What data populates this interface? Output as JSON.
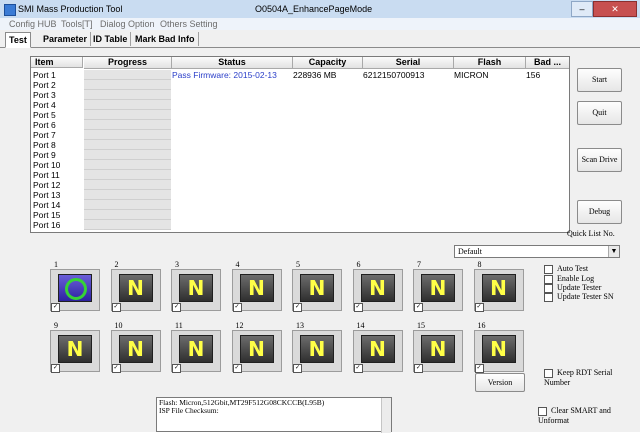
{
  "app": {
    "title": "SMI Mass Production Tool",
    "window_title": "O0504A_EnhancePageMode"
  },
  "menu": [
    "Config HUB",
    "Tools[T]",
    "Dialog Option",
    "Others Setting"
  ],
  "tabs": [
    "Test",
    "Parameter",
    "ID Table",
    "Mark Bad Info"
  ],
  "table": {
    "headers": [
      "Item",
      "Progress",
      "Status",
      "Capacity",
      "Serial",
      "Flash",
      "Bad ..."
    ],
    "rows": [
      {
        "item": "Port 1",
        "status": "Pass   Firmware: 2015-02-13",
        "capacity": "228936 MB",
        "serial": "6212150700913",
        "flash": "MICRON",
        "bad": "156"
      },
      {
        "item": "Port 2",
        "status": "",
        "capacity": "",
        "serial": "",
        "flash": "",
        "bad": ""
      },
      {
        "item": "Port 3",
        "status": "",
        "capacity": "",
        "serial": "",
        "flash": "",
        "bad": ""
      },
      {
        "item": "Port 4",
        "status": "",
        "capacity": "",
        "serial": "",
        "flash": "",
        "bad": ""
      },
      {
        "item": "Port 5",
        "status": "",
        "capacity": "",
        "serial": "",
        "flash": "",
        "bad": ""
      },
      {
        "item": "Port 6",
        "status": "",
        "capacity": "",
        "serial": "",
        "flash": "",
        "bad": ""
      },
      {
        "item": "Port 7",
        "status": "",
        "capacity": "",
        "serial": "",
        "flash": "",
        "bad": ""
      },
      {
        "item": "Port 8",
        "status": "",
        "capacity": "",
        "serial": "",
        "flash": "",
        "bad": ""
      },
      {
        "item": "Port 9",
        "status": "",
        "capacity": "",
        "serial": "",
        "flash": "",
        "bad": ""
      },
      {
        "item": "Port 10",
        "status": "",
        "capacity": "",
        "serial": "",
        "flash": "",
        "bad": ""
      },
      {
        "item": "Port 11",
        "status": "",
        "capacity": "",
        "serial": "",
        "flash": "",
        "bad": ""
      },
      {
        "item": "Port 12",
        "status": "",
        "capacity": "",
        "serial": "",
        "flash": "",
        "bad": ""
      },
      {
        "item": "Port 13",
        "status": "",
        "capacity": "",
        "serial": "",
        "flash": "",
        "bad": ""
      },
      {
        "item": "Port 14",
        "status": "",
        "capacity": "",
        "serial": "",
        "flash": "",
        "bad": ""
      },
      {
        "item": "Port 15",
        "status": "",
        "capacity": "",
        "serial": "",
        "flash": "",
        "bad": ""
      },
      {
        "item": "Port 16",
        "status": "",
        "capacity": "",
        "serial": "",
        "flash": "",
        "bad": ""
      }
    ]
  },
  "buttons": {
    "start": "Start",
    "quit": "Quit",
    "scan_drive": "Scan Drive",
    "debug": "Debug",
    "version": "Version"
  },
  "quick_list": {
    "label": "Quick List No.",
    "selected": "Default"
  },
  "ports": [
    {
      "num": "1",
      "letter": "O",
      "state": "ok"
    },
    {
      "num": "2",
      "letter": "N",
      "state": "none"
    },
    {
      "num": "3",
      "letter": "N",
      "state": "none"
    },
    {
      "num": "4",
      "letter": "N",
      "state": "none"
    },
    {
      "num": "5",
      "letter": "N",
      "state": "none"
    },
    {
      "num": "6",
      "letter": "N",
      "state": "none"
    },
    {
      "num": "7",
      "letter": "N",
      "state": "none"
    },
    {
      "num": "8",
      "letter": "N",
      "state": "none"
    },
    {
      "num": "9",
      "letter": "N",
      "state": "none"
    },
    {
      "num": "10",
      "letter": "N",
      "state": "none"
    },
    {
      "num": "11",
      "letter": "N",
      "state": "none"
    },
    {
      "num": "12",
      "letter": "N",
      "state": "none"
    },
    {
      "num": "13",
      "letter": "N",
      "state": "none"
    },
    {
      "num": "14",
      "letter": "N",
      "state": "none"
    },
    {
      "num": "15",
      "letter": "N",
      "state": "none"
    },
    {
      "num": "16",
      "letter": "N",
      "state": "none"
    }
  ],
  "options": [
    "Auto Test",
    "Enable Log",
    "Update Tester",
    "Update Tester SN"
  ],
  "keep_rdt": "Keep RDT Serial Number",
  "clear_smart": "Clear SMART and Unformat",
  "log_lines": [
    "Flash: Micron,512Gbit,MT29F512G08CKCCB(L95B)",
    "ISP File Checksum:"
  ],
  "colors": {
    "status_blue": "#2a3ec9",
    "ok_ring": "#36d236",
    "port_letter": "#ffff47"
  }
}
